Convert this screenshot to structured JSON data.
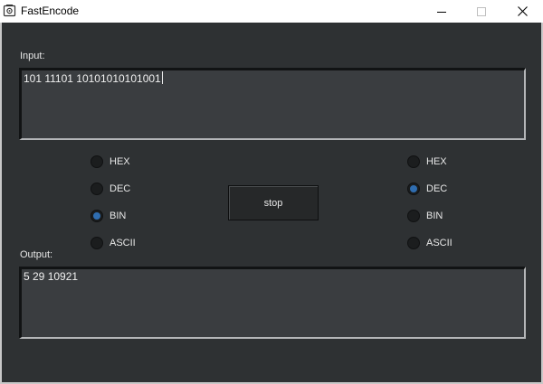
{
  "window": {
    "title": "FastEncode",
    "controls": {
      "minimize_icon": "minimize-icon",
      "maximize_icon": "maximize-icon",
      "close_icon": "close-icon"
    }
  },
  "input": {
    "label": "Input:",
    "value": "101 11101 10101010101001"
  },
  "output": {
    "label": "Output:",
    "value": "5 29 10921"
  },
  "input_formats": {
    "options": [
      "HEX",
      "DEC",
      "BIN",
      "ASCII"
    ],
    "selected": "BIN"
  },
  "output_formats": {
    "options": [
      "HEX",
      "DEC",
      "BIN",
      "ASCII"
    ],
    "selected": "DEC"
  },
  "action": {
    "button_label": "stop"
  },
  "colors": {
    "background": "#2e3133",
    "radio_selected": "#2f6db0",
    "text": "#e8e8e8"
  }
}
